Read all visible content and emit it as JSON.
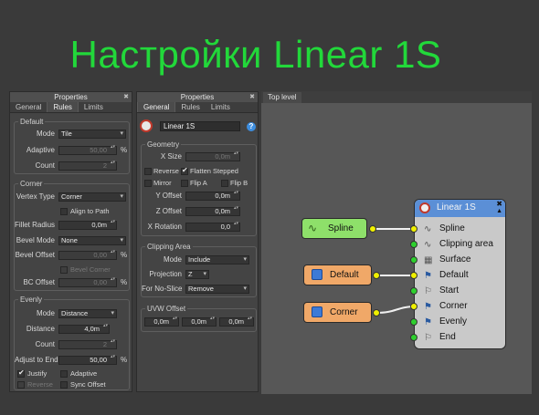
{
  "heading": "Настройки Linear 1S",
  "panel1": {
    "title": "Properties",
    "tabs": [
      "General",
      "Rules",
      "Limits"
    ],
    "default_group": {
      "label": "Default",
      "mode_label": "Mode",
      "mode_value": "Tile",
      "adaptive_label": "Adaptive",
      "adaptive_value": "50,00",
      "adaptive_unit": "%",
      "count_label": "Count",
      "count_value": "2"
    },
    "corner_group": {
      "label": "Corner",
      "vertex_type_label": "Vertex Type",
      "vertex_type_value": "Corner",
      "align_to_path": "Align to Path",
      "fillet_radius_label": "Fillet Radius",
      "fillet_radius_value": "0,0m",
      "bevel_mode_label": "Bevel Mode",
      "bevel_mode_value": "None",
      "bevel_offset_label": "Bevel Offset",
      "bevel_offset_value": "0,00",
      "bevel_offset_unit": "%",
      "bevel_corner": "Bevel Corner",
      "bc_offset_label": "BC Offset",
      "bc_offset_value": "0,00",
      "bc_offset_unit": "%"
    },
    "evenly_group": {
      "label": "Evenly",
      "mode_label": "Mode",
      "mode_value": "Distance",
      "distance_label": "Distance",
      "distance_value": "4,0m",
      "count_label": "Count",
      "count_value": "2",
      "adjust_label": "Adjust to End",
      "adjust_value": "50,00",
      "adjust_unit": "%",
      "justify": "Justify",
      "adaptive": "Adaptive",
      "reverse": "Reverse",
      "sync_offset": "Sync Offset"
    }
  },
  "panel2": {
    "title": "Properties",
    "tabs": [
      "General",
      "Rules",
      "Limits"
    ],
    "name_value": "Linear 1S",
    "help": "?",
    "geometry": {
      "label": "Geometry",
      "xsize_label": "X Size",
      "xsize_value": "0,0m",
      "reverse": "Reverse",
      "flatten_stepped": "Flatten Stepped",
      "mirror": "Mirror",
      "flip_a": "Flip A",
      "flip_b": "Flip B",
      "yoffset_label": "Y Offset",
      "yoffset_value": "0,0m",
      "zoffset_label": "Z Offset",
      "zoffset_value": "0,0m",
      "xrotation_label": "X Rotation",
      "xrotation_value": "0,0"
    },
    "clipping": {
      "label": "Clipping Area",
      "mode_label": "Mode",
      "mode_value": "Include",
      "projection_label": "Projection",
      "projection_value": "Z",
      "noslice_label": "For No-Slice",
      "noslice_value": "Remove"
    },
    "uvw": {
      "label": "UVW Offset",
      "values": [
        "0,0m",
        "0,0m",
        "0,0m"
      ]
    }
  },
  "graph": {
    "tab": "Top level",
    "nodes": {
      "spline": "Spline",
      "default": "Default",
      "corner": "Corner",
      "linear_title": "Linear 1S"
    },
    "slots": [
      "Spline",
      "Clipping area",
      "Surface",
      "Default",
      "Start",
      "Corner",
      "Evenly",
      "End"
    ],
    "colors": {
      "spline_node": "#8ee06a",
      "material_node": "#f0a868",
      "main_node_body": "#c9c9c9",
      "main_node_header": "#5b8fd6",
      "port_yellow": "#f0f000",
      "port_green": "#2ed02e"
    }
  }
}
